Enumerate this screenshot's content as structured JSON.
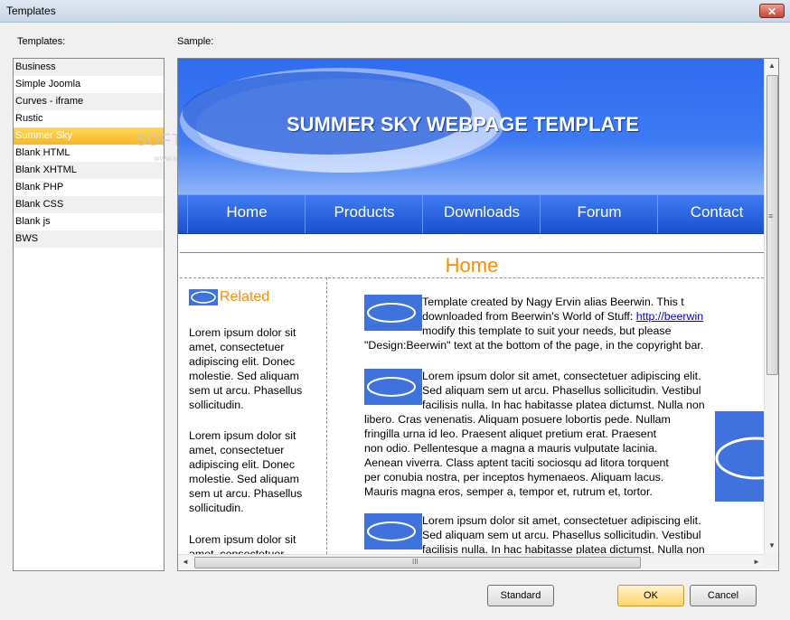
{
  "window": {
    "title": "Templates",
    "close_glyph": "✕"
  },
  "labels": {
    "templates": "Templates:",
    "sample": "Sample:"
  },
  "templates": [
    "Business",
    "Simple Joomla",
    "Curves - iframe",
    "Rustic",
    "Summer Sky",
    "Blank HTML",
    "Blank XHTML",
    "Blank PHP",
    "Blank CSS",
    "Blank js",
    "BWS"
  ],
  "selected_template": "Summer Sky",
  "watermark": {
    "brand": "SOFTPEDIA",
    "url": "www.softpedia.com"
  },
  "preview": {
    "banner_title": "SUMMER SKY WEBPAGE TEMPLATE",
    "nav": [
      "Home",
      "Products",
      "Downloads",
      "Forum",
      "Contact"
    ],
    "page_heading": "Home",
    "related_heading": "Related",
    "left_paragraphs": [
      [
        "Lorem ipsum dolor sit",
        "amet, consectetuer",
        "adipiscing elit. Donec",
        "molestie. Sed aliquam",
        "sem ut arcu. Phasellus",
        "sollicitudin."
      ],
      [
        "Lorem ipsum dolor sit",
        "amet, consectetuer",
        "adipiscing elit. Donec",
        "molestie. Sed aliquam",
        "sem ut arcu. Phasellus",
        "sollicitudin."
      ],
      [
        "Lorem ipsum dolor sit",
        "amet, consectetuer"
      ]
    ],
    "intro_lines": [
      "Template created by Nagy Ervin alias Beerwin. This t",
      "downloaded from Beerwin's World of Stuff: ",
      "modify this template to suit your needs, but please",
      "\"Design:Beerwin\" text at the bottom of the page, in the copyright bar."
    ],
    "intro_link": "http://beerwin",
    "para2_lines": [
      "Lorem ipsum dolor sit amet, consectetuer adipiscing elit.",
      "Sed aliquam sem ut arcu. Phasellus sollicitudin. Vestibul",
      "facilisis nulla. In hac habitasse platea dictumst. Nulla non",
      "libero. Cras venenatis. Aliquam posuere lobortis pede. Nullam",
      "fringilla urna id leo. Praesent aliquet pretium erat. Praesent",
      "non odio. Pellentesque a magna a mauris vulputate lacinia.",
      "Aenean viverra. Class aptent taciti sociosqu ad litora torquent",
      "per conubia nostra, per inceptos hymenaeos. Aliquam lacus.",
      "Mauris magna eros, semper a, tempor et, rutrum et, tortor."
    ],
    "para3_lines": [
      "Lorem ipsum dolor sit amet, consectetuer adipiscing elit.",
      "Sed aliquam sem ut arcu. Phasellus sollicitudin. Vestibul",
      "facilisis nulla. In hac habitasse platea dictumst. Nulla non"
    ]
  },
  "buttons": {
    "standard": "Standard",
    "ok": "OK",
    "cancel": "Cancel"
  },
  "scroll_glyphs": {
    "up": "▲",
    "down": "▼",
    "left": "◄",
    "right": "►",
    "grip_v": "≡",
    "grip_h": "III"
  },
  "colors": {
    "selection": "#f7b624",
    "accent_orange": "#ff8c00",
    "banner_blue": "#2f6cf0"
  }
}
